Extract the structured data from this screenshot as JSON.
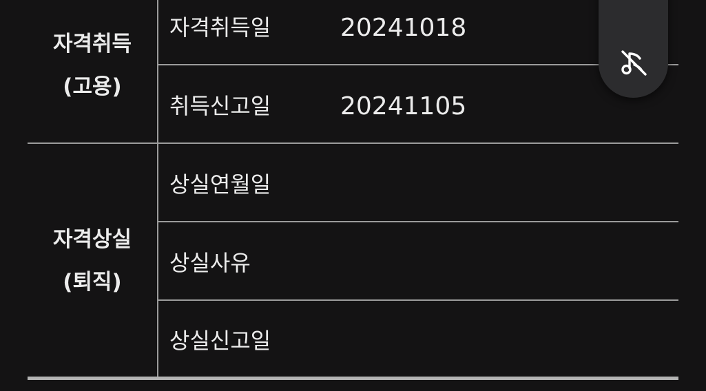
{
  "table": {
    "groups": [
      {
        "line1": "자격취득",
        "line2": "(고용)"
      },
      {
        "line1": "자격상실",
        "line2": "(퇴직)"
      }
    ],
    "rows": [
      {
        "label": "자격취득일",
        "value": "20241018"
      },
      {
        "label": "취득신고일",
        "value": "20241105"
      },
      {
        "label": "상실연월일",
        "value": ""
      },
      {
        "label": "상실사유",
        "value": ""
      },
      {
        "label": "상실신고일",
        "value": ""
      }
    ]
  },
  "floating_button": {
    "icon": "audio-off-icon"
  }
}
